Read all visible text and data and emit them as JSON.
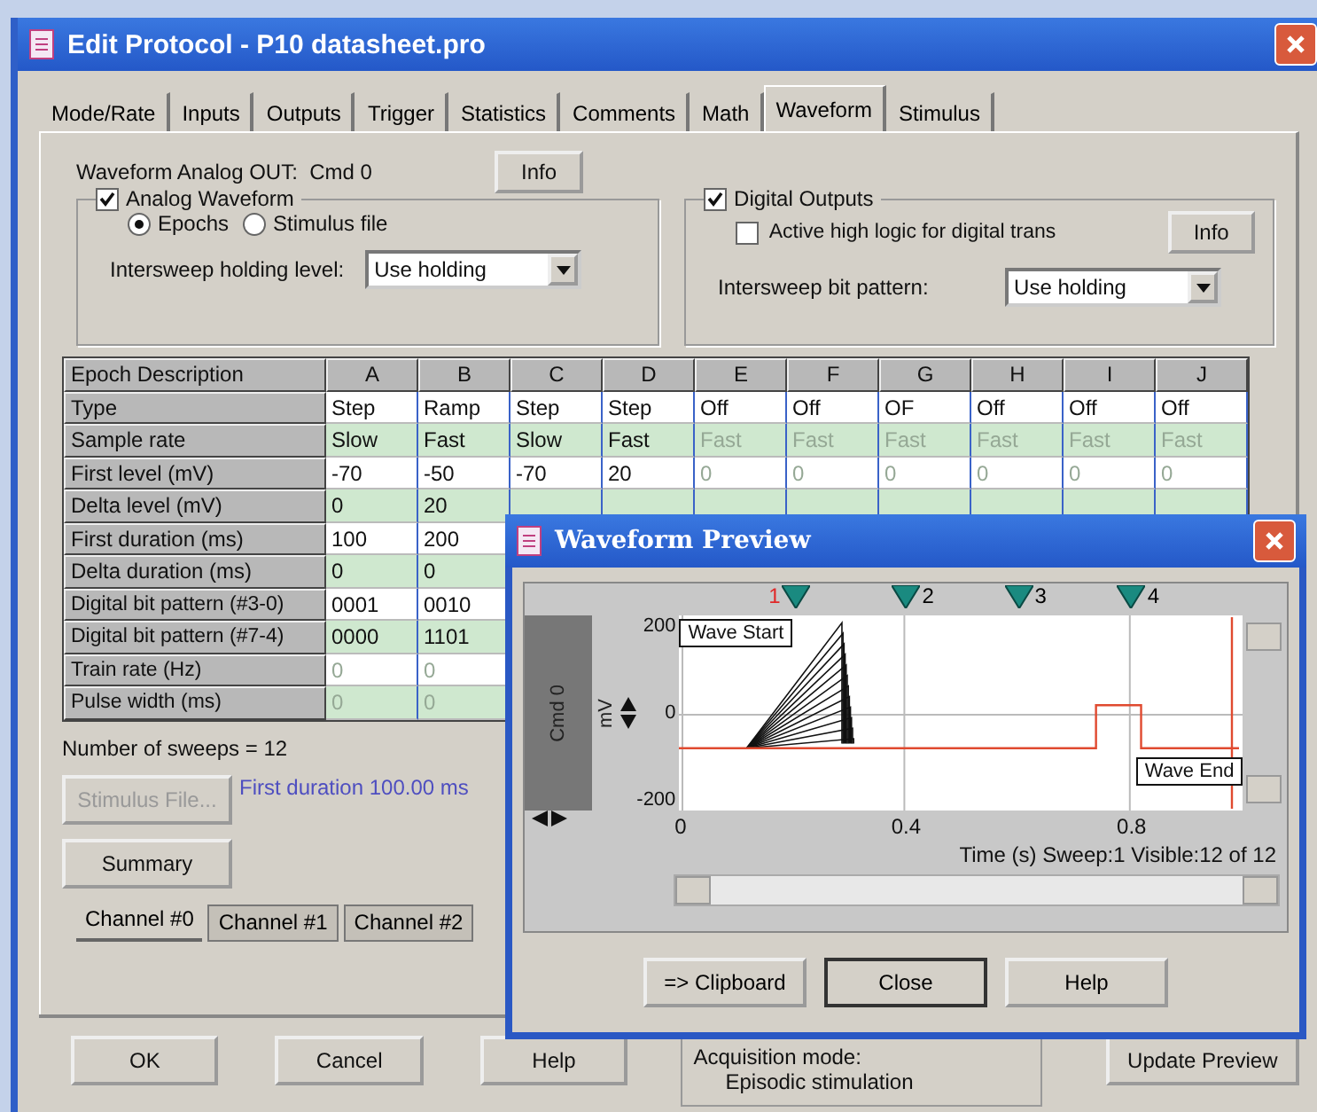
{
  "window": {
    "title": "Edit Protocol - P10 datasheet.pro"
  },
  "tabs": [
    {
      "label": "Mode/Rate",
      "selected": false
    },
    {
      "label": "Inputs",
      "selected": false
    },
    {
      "label": "Outputs",
      "selected": false
    },
    {
      "label": "Trigger",
      "selected": false
    },
    {
      "label": "Statistics",
      "selected": false
    },
    {
      "label": "Comments",
      "selected": false
    },
    {
      "label": "Math",
      "selected": false
    },
    {
      "label": "Waveform",
      "selected": true
    },
    {
      "label": "Stimulus",
      "selected": false
    }
  ],
  "analog_out": {
    "label": "Waveform Analog OUT:  Cmd 0",
    "info_button": "Info"
  },
  "analog_group": {
    "label": "Analog Waveform",
    "checked": true,
    "radios": [
      {
        "label": "Epochs",
        "selected": true
      },
      {
        "label": "Stimulus file",
        "selected": false
      }
    ],
    "holding_label": "Intersweep holding level:",
    "holding_value": "Use holding"
  },
  "digital_group": {
    "label": "Digital Outputs",
    "checked": true,
    "active_high": {
      "label": "Active high logic for digital trans",
      "checked": false
    },
    "info_button": "Info",
    "pattern_label": "Intersweep bit pattern:",
    "pattern_value": "Use holding"
  },
  "epoch_table": {
    "corner": "Epoch Description",
    "columns": [
      "A",
      "B",
      "C",
      "D",
      "E",
      "F",
      "G",
      "H",
      "I",
      "J"
    ],
    "rows": [
      {
        "label": "Type",
        "cells": [
          {
            "text": "Step",
            "disabled": false
          },
          {
            "text": "Ramp",
            "disabled": false
          },
          {
            "text": "Step",
            "disabled": false
          },
          {
            "text": "Step",
            "disabled": false
          },
          {
            "text": "Off",
            "disabled": false
          },
          {
            "text": "Off",
            "disabled": false
          },
          {
            "text": "OF",
            "disabled": false
          },
          {
            "text": "Off",
            "disabled": false
          },
          {
            "text": "Off",
            "disabled": false
          },
          {
            "text": "Off",
            "disabled": false
          }
        ]
      },
      {
        "label": "Sample rate",
        "cells": [
          {
            "text": "Slow",
            "disabled": false
          },
          {
            "text": "Fast",
            "disabled": false
          },
          {
            "text": "Slow",
            "disabled": false
          },
          {
            "text": "Fast",
            "disabled": false
          },
          {
            "text": "Fast",
            "disabled": true
          },
          {
            "text": "Fast",
            "disabled": true
          },
          {
            "text": "Fast",
            "disabled": true
          },
          {
            "text": "Fast",
            "disabled": true
          },
          {
            "text": "Fast",
            "disabled": true
          },
          {
            "text": "Fast",
            "disabled": true
          }
        ]
      },
      {
        "label": "First level (mV)",
        "cells": [
          {
            "text": "-70",
            "disabled": false
          },
          {
            "text": "-50",
            "disabled": false
          },
          {
            "text": "-70",
            "disabled": false
          },
          {
            "text": "20",
            "disabled": false
          },
          {
            "text": "0",
            "disabled": true
          },
          {
            "text": "0",
            "disabled": true
          },
          {
            "text": "0",
            "disabled": true
          },
          {
            "text": "0",
            "disabled": true
          },
          {
            "text": "0",
            "disabled": true
          },
          {
            "text": "0",
            "disabled": true
          }
        ]
      },
      {
        "label": "Delta level (mV)",
        "cells": [
          {
            "text": "0",
            "disabled": false
          },
          {
            "text": "20",
            "disabled": false
          }
        ]
      },
      {
        "label": "First duration (ms)",
        "cells": [
          {
            "text": "100",
            "disabled": false
          },
          {
            "text": "200",
            "disabled": false
          }
        ]
      },
      {
        "label": "Delta duration (ms)",
        "cells": [
          {
            "text": "0",
            "disabled": false
          },
          {
            "text": "0",
            "disabled": false
          }
        ]
      },
      {
        "label": "Digital bit pattern (#3-0)",
        "cells": [
          {
            "text": "0001",
            "disabled": false
          },
          {
            "text": "0010",
            "disabled": false
          }
        ]
      },
      {
        "label": "Digital bit pattern (#7-4)",
        "cells": [
          {
            "text": "0000",
            "disabled": false
          },
          {
            "text": "1101",
            "disabled": false
          }
        ]
      },
      {
        "label": "Train rate (Hz)",
        "cells": [
          {
            "text": "0",
            "disabled": true
          },
          {
            "text": "0",
            "disabled": true
          }
        ]
      },
      {
        "label": "Pulse width (ms)",
        "cells": [
          {
            "text": "0",
            "disabled": true
          },
          {
            "text": "0",
            "disabled": true
          }
        ]
      }
    ]
  },
  "sweeps": "Number of sweeps = 12",
  "stimulus_button": {
    "label": "Stimulus File...",
    "disabled": true
  },
  "first_duration": "First duration 100.00 ms",
  "summary_button": "Summary",
  "channel_tabs": [
    {
      "label": "Channel #0",
      "selected": true
    },
    {
      "label": "Channel #1",
      "selected": false
    },
    {
      "label": "Channel #2",
      "selected": false
    }
  ],
  "buttons": [
    "OK",
    "Cancel",
    "Help"
  ],
  "acquisition": {
    "label": "Acquisition mode:",
    "value": "Episodic stimulation"
  },
  "update_button": "Update Preview",
  "preview": {
    "title": "Waveform Preview",
    "markers": [
      {
        "label": "1",
        "color": "#e02828"
      },
      {
        "label": "2",
        "color": "#000000"
      },
      {
        "label": "3",
        "color": "#000000"
      },
      {
        "label": "4",
        "color": "#000000"
      }
    ],
    "channel": "Cmd 0",
    "units": "mV",
    "y_ticks": [
      "200",
      "0",
      "-200"
    ],
    "x_ticks": [
      "0",
      "0.4",
      "0.8"
    ],
    "wave_start": "Wave Start",
    "wave_end": "Wave End",
    "status": "Time (s)  Sweep:1  Visible:12 of 12",
    "buttons": [
      "=> Clipboard",
      "Close",
      "Help"
    ]
  }
}
